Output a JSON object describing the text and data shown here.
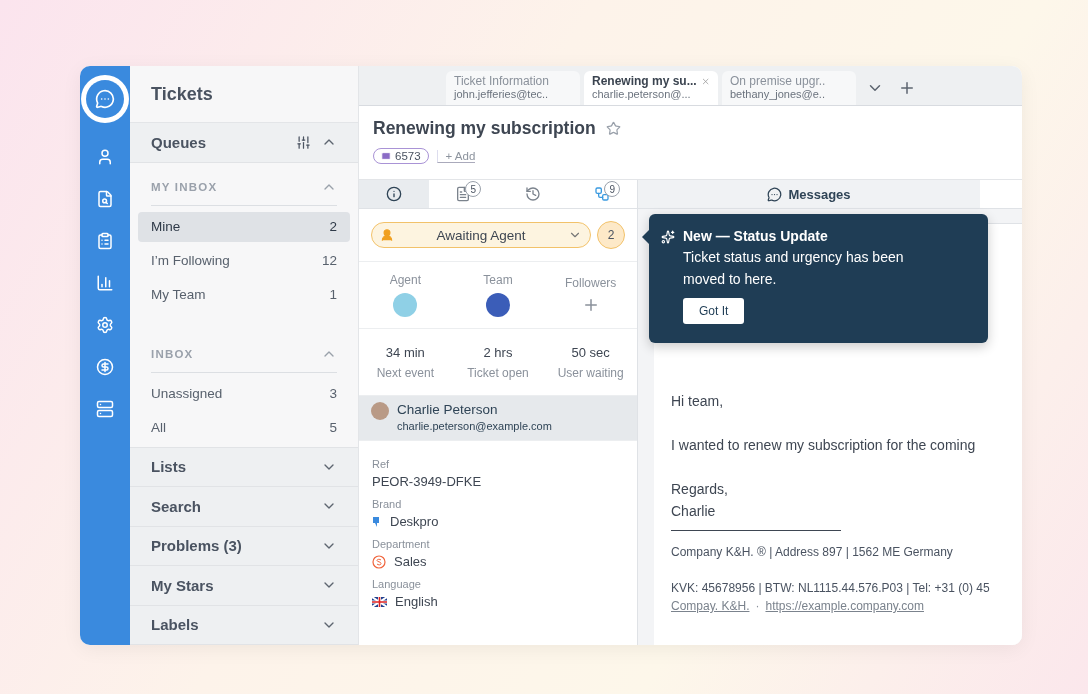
{
  "rail": [
    {
      "kind": "chat",
      "selected": true
    },
    {
      "kind": "contact",
      "selected": false
    },
    {
      "kind": "search",
      "selected": false
    },
    {
      "kind": "task",
      "selected": false
    },
    {
      "kind": "report",
      "selected": false
    },
    {
      "kind": "settings",
      "selected": false
    },
    {
      "kind": "billing",
      "selected": false
    },
    {
      "kind": "server",
      "selected": false
    }
  ],
  "sidebar": {
    "title": "Tickets",
    "queues": {
      "label": "Queues",
      "expanded": true,
      "groups": [
        {
          "label": "MY INBOX",
          "expanded": true,
          "items": [
            {
              "label": "Mine",
              "count": "2",
              "selected": true
            },
            {
              "label": "I’m Following",
              "count": "12",
              "selected": false
            },
            {
              "label": "My Team",
              "count": "1",
              "selected": false
            }
          ]
        },
        {
          "label": "INBOX",
          "expanded": true,
          "items": [
            {
              "label": "Unassigned",
              "count": "3",
              "selected": false
            },
            {
              "label": "All",
              "count": "5",
              "selected": false
            }
          ]
        }
      ]
    },
    "sections": [
      {
        "label": "Lists",
        "expanded": false
      },
      {
        "label": "Search",
        "expanded": false
      },
      {
        "label": "Problems (3)",
        "expanded": false
      },
      {
        "label": "My Stars",
        "expanded": false
      },
      {
        "label": "Labels",
        "expanded": false
      }
    ]
  },
  "tabs": [
    {
      "title": "Ticket Information",
      "subtitle": "john.jefferies@tec..",
      "selected": false,
      "closable": false
    },
    {
      "title": "Renewing my su...",
      "subtitle": "charlie.peterson@...",
      "selected": true,
      "closable": true
    },
    {
      "title": "On premise upgr..",
      "subtitle": "bethany_jones@e..",
      "selected": false,
      "closable": false
    }
  ],
  "ticket": {
    "title": "Renewing my subscription",
    "starred": false,
    "id": "6573",
    "add_label": "+ Add"
  },
  "panel_tabs": [
    {
      "kind": "info",
      "selected": true
    },
    {
      "kind": "notes",
      "badge": "5",
      "selected": false
    },
    {
      "kind": "history",
      "selected": false
    },
    {
      "kind": "linked",
      "badge": "9",
      "selected": false
    }
  ],
  "status": {
    "label": "Awaiting Agent",
    "urgency": "2"
  },
  "people": [
    {
      "label": "Agent",
      "kind": "avatar"
    },
    {
      "label": "Team",
      "kind": "team"
    },
    {
      "label": "Followers",
      "kind": "add"
    }
  ],
  "timers": [
    {
      "value": "34 min",
      "label": "Next event"
    },
    {
      "value": "2 hrs",
      "label": "Ticket open"
    },
    {
      "value": "50 sec",
      "label": "User waiting"
    }
  ],
  "user": {
    "name": "Charlie Peterson",
    "email": "charlie.peterson@example.com"
  },
  "fields": [
    {
      "label": "Ref",
      "value": "PEOR-3949-DFKE",
      "kind": "plain"
    },
    {
      "label": "Brand",
      "value": "Deskpro",
      "kind": "brand"
    },
    {
      "label": "Department",
      "value": "Sales",
      "kind": "department"
    },
    {
      "label": "Language",
      "value": "English",
      "kind": "flag"
    }
  ],
  "messages_tab": {
    "label": "Messages"
  },
  "email": {
    "greeting": "Hi team,",
    "body": "I wanted to renew my subscription for the coming",
    "signoff": "Regards,",
    "name": "Charlie",
    "footer_1": "Company K&H. ® | Address 897 | 1562 ME Germany",
    "footer_2": "KVK: 45678956 | BTW: NL1115.44.576.P03 | Tel: +31 (0) 45",
    "links": [
      "Compay. K&H.",
      "https://example.company.com"
    ],
    "link_separator": "·"
  },
  "tooltip": {
    "title": "New — Status Update",
    "body": "Ticket status and urgency has been moved to here.",
    "button": "Got It"
  }
}
